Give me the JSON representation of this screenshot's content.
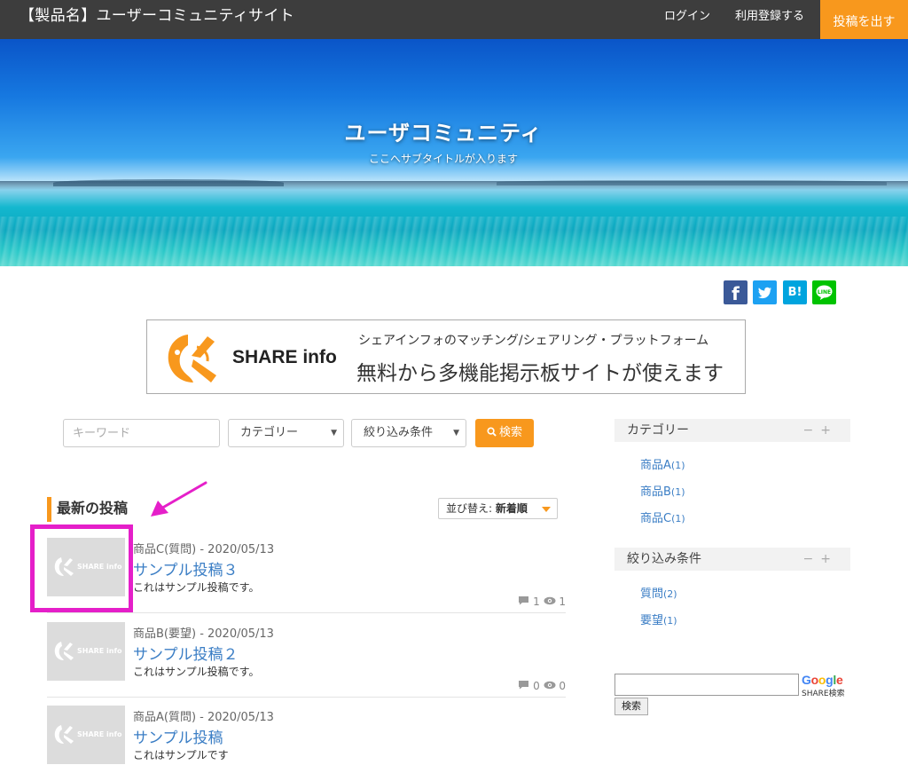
{
  "header": {
    "site_title": "【製品名】ユーザーコミュニティサイト",
    "login": "ログイン",
    "register": "利用登録する",
    "post_button": "投稿を出す"
  },
  "hero": {
    "title": "ユーザコミュニティ",
    "subtitle": "ここへサブタイトルが入ります"
  },
  "share_icons": [
    "facebook-icon",
    "twitter-icon",
    "hatena-bookmark-icon",
    "line-icon"
  ],
  "share_labels": {
    "hatena": "B!",
    "line": "LINE",
    "facebook": "f"
  },
  "banner": {
    "brand": "SHARE info",
    "line1": "シェアインフォのマッチング/シェアリング・プラットフォーム",
    "line2": "無料から多機能掲示板サイトが使えます"
  },
  "search": {
    "keyword_placeholder": "キーワード",
    "category_select": "カテゴリー",
    "filter_select": "絞り込み条件",
    "button": "検索"
  },
  "latest": {
    "title": "最新の投稿",
    "sort_label": "並び替え:",
    "sort_value": "新着順"
  },
  "posts": [
    {
      "meta": "商品C(質問) - 2020/05/13",
      "title": "サンプル投稿３",
      "excerpt": "これはサンプル投稿です。",
      "comments": "1",
      "views": "1",
      "thumb_text": "SHARE info"
    },
    {
      "meta": "商品B(要望) - 2020/05/13",
      "title": "サンプル投稿２",
      "excerpt": "これはサンプル投稿です。",
      "comments": "0",
      "views": "0",
      "thumb_text": "SHARE info"
    },
    {
      "meta": "商品A(質問) - 2020/05/13",
      "title": "サンプル投稿",
      "excerpt": "これはサンプルです",
      "thumb_text": "SHARE info"
    }
  ],
  "sidebar": {
    "category_title": "カテゴリー",
    "categories": [
      {
        "label": "商品A",
        "count": "(1)"
      },
      {
        "label": "商品B",
        "count": "(1)"
      },
      {
        "label": "商品C",
        "count": "(1)"
      }
    ],
    "filter_title": "絞り込み条件",
    "filters": [
      {
        "label": "質問",
        "count": "(2)"
      },
      {
        "label": "要望",
        "count": "(1)"
      }
    ],
    "controls": "−+"
  },
  "google": {
    "logo": "Google",
    "sub": "SHARE検索",
    "button": "検索"
  },
  "colors": {
    "accent_orange": "#f8981d",
    "link_blue": "#3b7ec5",
    "header_bg": "#3d3d3d",
    "annotation_magenta": "#e51fc9"
  }
}
